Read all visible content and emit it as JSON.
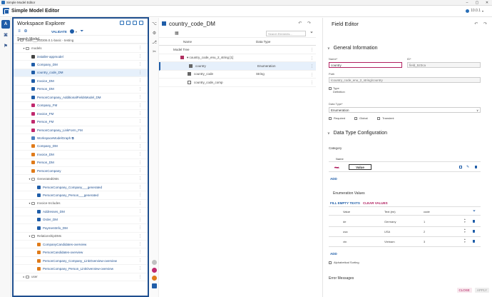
{
  "window": {
    "title": "Simple Model Editor",
    "controls": [
      "–",
      "▢",
      "✕"
    ]
  },
  "header": {
    "app_title": "Simple Model Editor",
    "version": "10.0.1"
  },
  "rail": [
    "A",
    "⌘",
    "⚑"
  ],
  "explorer": {
    "title": "Workspace Explorer",
    "validate_label": "VALIDATE",
    "search_placeholder": "Search Model...",
    "tree": [
      {
        "indent": 0,
        "caret": "▾",
        "kind": "folder",
        "label": "basic__202306.0.1-basic - testing"
      },
      {
        "indent": 1,
        "caret": "▾",
        "kind": "folder",
        "label": "models"
      },
      {
        "indent": 2,
        "caret": "",
        "kind": "inst",
        "label": "installer-appmodel"
      },
      {
        "indent": 2,
        "caret": "",
        "kind": "dm",
        "label": "Company_DM"
      },
      {
        "indent": 2,
        "caret": "",
        "kind": "dm",
        "label": "country_code_DM",
        "selected": true
      },
      {
        "indent": 2,
        "caret": "",
        "kind": "dm",
        "label": "Invoice_DM"
      },
      {
        "indent": 2,
        "caret": "",
        "kind": "dm",
        "label": "Person_DM"
      },
      {
        "indent": 2,
        "caret": "",
        "kind": "dm",
        "label": "PersonCompany_AdditionalFieldsModel_DM"
      },
      {
        "indent": 2,
        "caret": "",
        "kind": "fm",
        "label": "Company_FM"
      },
      {
        "indent": 2,
        "caret": "",
        "kind": "fm",
        "label": "Invoice_FM"
      },
      {
        "indent": 2,
        "caret": "",
        "kind": "fm",
        "label": "Person_FM"
      },
      {
        "indent": 2,
        "caret": "",
        "kind": "fm",
        "label": "PersonCompany_LinkForm_FM"
      },
      {
        "indent": 2,
        "caret": "",
        "kind": "wg",
        "label": "WorkspaceModelGraph ⧉"
      },
      {
        "indent": 2,
        "caret": "",
        "kind": "vm",
        "label": "Company_DM"
      },
      {
        "indent": 2,
        "caret": "",
        "kind": "vm",
        "label": "Invoice_DM"
      },
      {
        "indent": 2,
        "caret": "",
        "kind": "vm",
        "label": "Person_DM"
      },
      {
        "indent": 2,
        "caret": "",
        "kind": "vm",
        "label": "PersonCompany"
      },
      {
        "indent": 2,
        "caret": "▾",
        "kind": "folder",
        "label": "GeneratedDMs"
      },
      {
        "indent": 3,
        "caret": "",
        "kind": "dm",
        "label": "PersonCompany_Company___generated"
      },
      {
        "indent": 3,
        "caret": "",
        "kind": "dm",
        "label": "PersonCompany_Person___generated"
      },
      {
        "indent": 2,
        "caret": "▾",
        "kind": "folder",
        "label": "Invoice-Includes"
      },
      {
        "indent": 3,
        "caret": "",
        "kind": "dm",
        "label": "Addresses_DM"
      },
      {
        "indent": 3,
        "caret": "",
        "kind": "dm",
        "label": "Order_DM"
      },
      {
        "indent": 3,
        "caret": "",
        "kind": "dm",
        "label": "PaymentInfo_DM"
      },
      {
        "indent": 2,
        "caret": "▾",
        "kind": "folder",
        "label": "RelationshipDMs"
      },
      {
        "indent": 3,
        "caret": "",
        "kind": "vm",
        "label": "CompanyCandidates-overview"
      },
      {
        "indent": 3,
        "caret": "",
        "kind": "vm",
        "label": "PersonCandidates-overview"
      },
      {
        "indent": 3,
        "caret": "",
        "kind": "vm",
        "label": "PersonCompany_Company_LinkOverview-overview"
      },
      {
        "indent": 3,
        "caret": "",
        "kind": "vm",
        "label": "PersonCompany_Person_LinkOverview-overview"
      },
      {
        "indent": 1,
        "caret": "▸",
        "kind": "folder",
        "label": "user"
      }
    ]
  },
  "dm": {
    "title": "country_code_DM",
    "search_placeholder": "Search Elements...",
    "col_name": "Name",
    "col_type": "Data Type",
    "rows": [
      {
        "indent": 0,
        "label": "Model Tree",
        "type": "",
        "kind": "none"
      },
      {
        "indent": 1,
        "label": "▾  country_code_enu_2_string [1]",
        "type": "",
        "kind": "dsl"
      },
      {
        "indent": 2,
        "label": "country",
        "type": "Enumeration",
        "kind": "inst",
        "selected": true
      },
      {
        "indent": 2,
        "label": "country_code",
        "type": "String",
        "kind": "inst"
      },
      {
        "indent": 2,
        "label": "country_code_comp",
        "type": "",
        "kind": "comp"
      }
    ]
  },
  "editor": {
    "title": "Field Editor",
    "general": "General Information",
    "name_label": "Name*",
    "name_value": "country",
    "id_label": "ID*",
    "id_value": "field_523ca",
    "path_label": "Path",
    "path_value": "/country_code_enu_2_string/country",
    "type_def": "Type\nDefinition",
    "datatype_label": "Data Type*",
    "datatype_value": "Enumeration",
    "flags": [
      "Required",
      "Global",
      "Transient"
    ],
    "dtconfig": "Data Type Configuration",
    "category": "Category",
    "cat_name_col": "Name",
    "cat_row": "Value",
    "add": "ADD",
    "enum_title": "Enumeration Values",
    "fill_empty": "FILL EMPTY TEXTS",
    "clear": "CLEAR VALUES",
    "enum_cols": [
      "Value",
      "Text (en)",
      "code"
    ],
    "enum_rows": [
      {
        "value": "de",
        "text": "Germany",
        "code": "1"
      },
      {
        "value": "usa",
        "text": "USA",
        "code": "2"
      },
      {
        "value": "vtn",
        "text": "Vietnam",
        "code": "3"
      }
    ],
    "alpha_sort": "Alphabetical Sorting",
    "errors": "Error Messages",
    "close": "CLOSE",
    "apply": "APPLY"
  },
  "colors": {
    "accent": "#1f5da8",
    "danger": "#b02060",
    "border": "#1f4f8f"
  }
}
